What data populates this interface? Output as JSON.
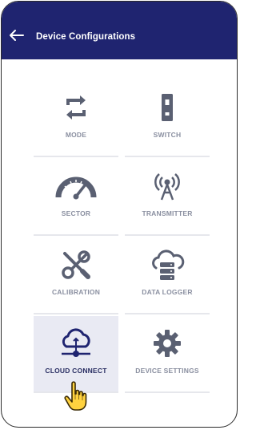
{
  "header": {
    "title": "Device Configurations",
    "back_icon": "arrow-left-icon",
    "background": "#1f2470"
  },
  "tiles": [
    {
      "label": "MODE",
      "icon": "swap-arrows-icon"
    },
    {
      "label": "SWITCH",
      "icon": "toggle-switch-icon"
    },
    {
      "label": "SECTOR",
      "icon": "speedometer-icon"
    },
    {
      "label": "TRANSMITTER",
      "icon": "antenna-icon"
    },
    {
      "label": "CALIBRATION",
      "icon": "wrench-screwdriver-icon"
    },
    {
      "label": "DATA LOGGER",
      "icon": "cloud-database-icon"
    },
    {
      "label": "CLOUD CONNECT",
      "icon": "cloud-network-icon",
      "selected": true
    },
    {
      "label": "DEVICE SETTINGS",
      "icon": "gear-icon"
    }
  ],
  "colors": {
    "icon": "#5a6072",
    "label": "#8a8fa0",
    "selected_tile": "#e9eaf3"
  }
}
